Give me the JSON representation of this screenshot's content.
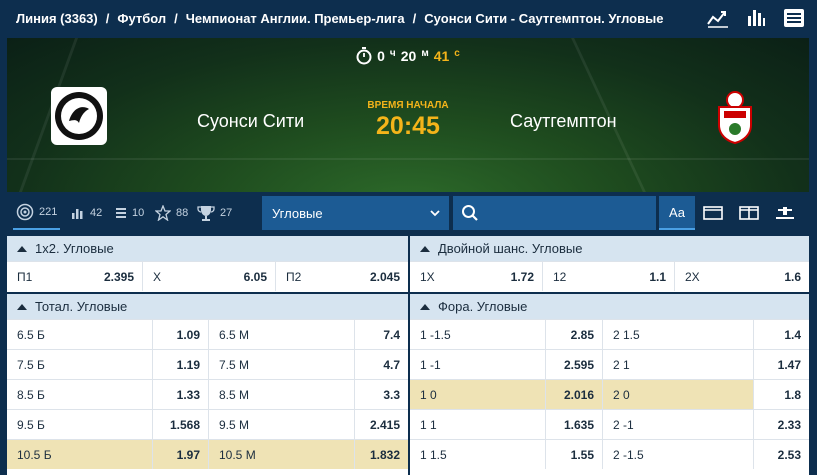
{
  "breadcrumb": {
    "items": [
      "Линия (3363)",
      "Футбол",
      "Чемпионат Англии. Премьер-лига",
      "Сyонси Сити - Саутгемптон. Угловые"
    ],
    "separator": "/"
  },
  "top_icons": [
    "stats-trend-icon",
    "bar-chart-icon",
    "menu-icon"
  ],
  "match": {
    "timer": {
      "hours": "0",
      "hours_unit": "ч",
      "minutes": "20",
      "minutes_unit": "м",
      "seconds": "41",
      "seconds_unit": "с"
    },
    "home_team": "Суонси Сити",
    "away_team": "Саутгемптон",
    "start_label": "ВРЕМЯ НАЧАЛА",
    "start_time": "20:45"
  },
  "filters": {
    "tabs": [
      {
        "icon": "target-icon",
        "count": "221"
      },
      {
        "icon": "list-chart-icon",
        "count": "42"
      },
      {
        "icon": "rank-icon",
        "count": "10"
      },
      {
        "icon": "star-icon",
        "count": "88"
      },
      {
        "icon": "trophy-icon",
        "count": "27"
      }
    ],
    "dropdown_value": "Угловые",
    "view_text_label": "Aa"
  },
  "markets": {
    "x12": {
      "title": "1х2. Угловые",
      "cells": [
        "П1",
        "2.395",
        "Х",
        "6.05",
        "П2",
        "2.045"
      ]
    },
    "double_chance": {
      "title": "Двойной шанс. Угловые",
      "cells": [
        "1Х",
        "1.72",
        "12",
        "1.1",
        "2Х",
        "1.6"
      ]
    },
    "total": {
      "title": "Тотал. Угловые",
      "rows": [
        [
          "6.5 Б",
          "1.09",
          "6.5 М",
          "7.4"
        ],
        [
          "7.5 Б",
          "1.19",
          "7.5 М",
          "4.7"
        ],
        [
          "8.5 Б",
          "1.33",
          "8.5 М",
          "3.3"
        ],
        [
          "9.5 Б",
          "1.568",
          "9.5 М",
          "2.415"
        ],
        [
          "10.5 Б",
          "1.97",
          "10.5 М",
          "1.832"
        ]
      ]
    },
    "handicap": {
      "title": "Фора. Угловые",
      "rows": [
        [
          "1 -1.5",
          "2.85",
          "2 1.5",
          "1.4"
        ],
        [
          "1 -1",
          "2.595",
          "2 1",
          "1.47"
        ],
        [
          "1 0",
          "2.016",
          "2 0",
          "1.8"
        ],
        [
          "1 1",
          "1.635",
          "2 -1",
          "2.33"
        ],
        [
          "1 1.5",
          "1.55",
          "2 -1.5",
          "2.53"
        ]
      ]
    }
  },
  "colors": {
    "navy": "#0d2e4e",
    "blue": "#1c5b94",
    "accent": "#f4b41a",
    "highlight": "#efe3b5",
    "header": "#d6e4f0"
  }
}
